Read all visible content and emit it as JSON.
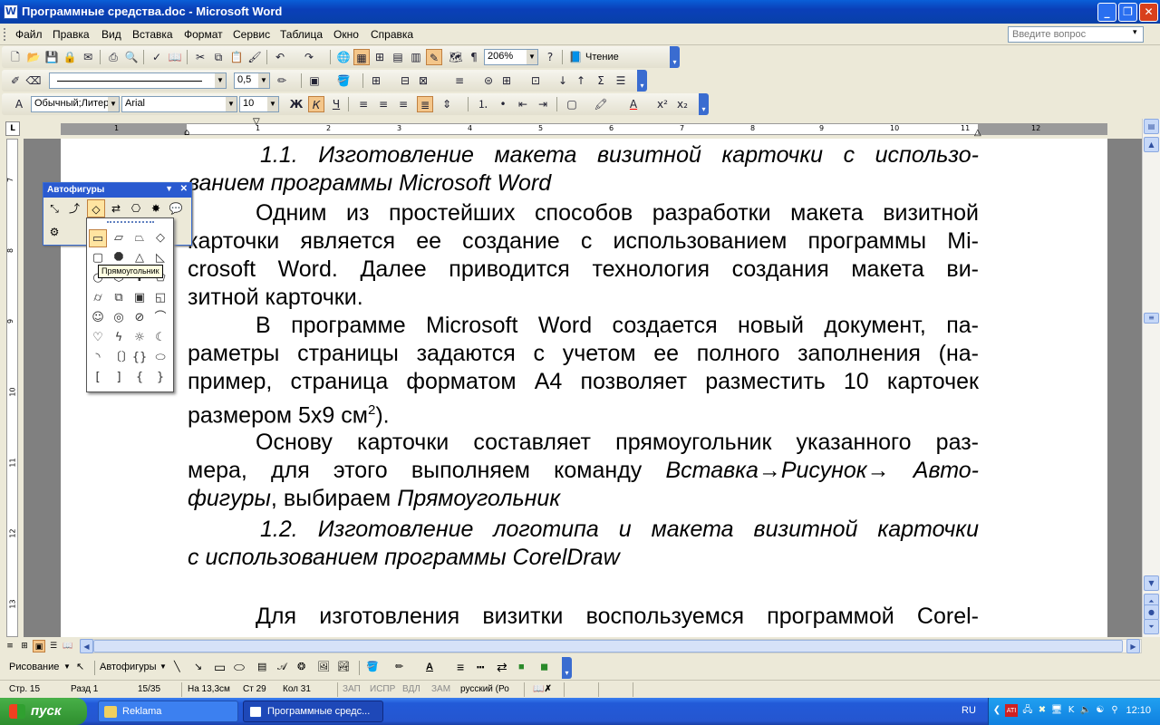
{
  "window": {
    "title": "Программные средства.doc - Microsoft Word",
    "app_icon": "W"
  },
  "menubar": {
    "items": [
      "Файл",
      "Правка",
      "Вид",
      "Вставка",
      "Формат",
      "Сервис",
      "Таблица",
      "Окно",
      "Справка"
    ],
    "ask_placeholder": "Введите вопрос"
  },
  "toolbar_standard": {
    "zoom": "206%",
    "reading_label": "Чтение"
  },
  "toolbar_tables": {
    "line_weight": "0,5"
  },
  "toolbar_format": {
    "style": "Обычный;Литер",
    "font": "Arial",
    "size": "10",
    "bold": "Ж",
    "italic": "К",
    "underline": "Ч"
  },
  "ruler": {
    "h_numbers": [
      "1",
      "1",
      "2",
      "3",
      "4",
      "5",
      "6",
      "7",
      "8",
      "9",
      "10",
      "11",
      "12"
    ],
    "v_numbers": [
      "7",
      "8",
      "9",
      "10",
      "11",
      "12",
      "13"
    ]
  },
  "document": {
    "p1": [
      "1.1. Изготовление макета визитной карточки с использо-",
      "ванием программы Microsoft Word"
    ],
    "p2": [
      "Одним из простейших способов разработки макета визитной",
      "карточки является ее создание с использованием программы Mi-",
      "crosoft Word. Далее приводится технология создания макета ви-",
      "зитной карточки."
    ],
    "p3": [
      "В программе Microsoft Word создается новый документ, па-",
      "раметры страницы задаются с учетом ее полного заполнения (на-",
      "пример, страница форматом А4 позволяет разместить 10 карточек",
      "размером 5х9 см"
    ],
    "p3_sup": "2",
    "p3_end": ").",
    "p4": [
      "Основу карточки составляет прямоугольник указанного раз-",
      "мера, для этого выполняем команду ",
      "фигуры",
      ", выбираем "
    ],
    "p4_italic": {
      "cmd1": "Вставка→Рисунок→ Авто-",
      "shape": "Прямоугольник"
    },
    "p5": [
      "1.2. Изготовление логотипа и макета визитной карточки",
      "с использованием программы CorelDraw"
    ],
    "p6": "Для изготовления визитки воспользуемся программой Corel-"
  },
  "autoshapes_panel": {
    "title": "Автофигуры",
    "tooltip": "Прямоугольник"
  },
  "drawing_toolbar": {
    "drawing_label": "Рисование",
    "autoshapes_label": "Автофигуры"
  },
  "statusbar": {
    "page": "Стр. 15",
    "section": "Разд 1",
    "pages": "15/35",
    "at": "На 13,3см",
    "line": "Ст 29",
    "col": "Кол 31",
    "rec": "ЗАП",
    "trk": "ИСПР",
    "ext": "ВДЛ",
    "ovr": "ЗАМ",
    "lang": "русский (Ро"
  },
  "taskbar": {
    "start": "пуск",
    "tasks": [
      "Reklama",
      "Программные средс..."
    ],
    "lang": "RU",
    "clock": "12:10"
  },
  "colors": {
    "titlebar": "#0a4fc8",
    "taskbar": "#2556d0",
    "start": "#2e8e2e"
  }
}
